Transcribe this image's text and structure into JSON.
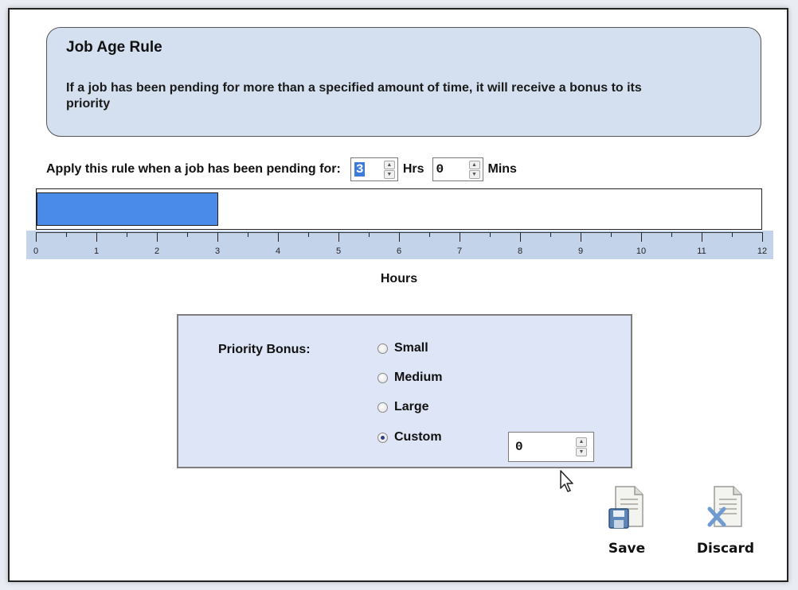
{
  "rule": {
    "title": "Job Age Rule",
    "description": "If a job has been pending for more than a specified amount of time, it will receive a bonus to its priority"
  },
  "apply": {
    "label": "Apply this rule when a job has been pending for:",
    "hours_value": "3",
    "hours_unit": "Hrs",
    "minutes_value": "0",
    "minutes_unit": "Mins"
  },
  "timeline": {
    "min": 0,
    "max": 12,
    "value": 3,
    "tick_labels": [
      "0",
      "1",
      "2",
      "3",
      "4",
      "5",
      "6",
      "7",
      "8",
      "9",
      "10",
      "11",
      "12"
    ],
    "axis_label": "Hours",
    "fill_color": "#4a8ae8"
  },
  "priority_bonus": {
    "label": "Priority Bonus:",
    "options": [
      "Small",
      "Medium",
      "Large",
      "Custom"
    ],
    "selected": "Custom",
    "custom_value": "0"
  },
  "actions": {
    "save_label": "Save",
    "discard_label": "Discard"
  },
  "icons": {
    "save": "save-icon",
    "discard": "discard-icon",
    "cursor": "mouse-cursor-icon"
  }
}
